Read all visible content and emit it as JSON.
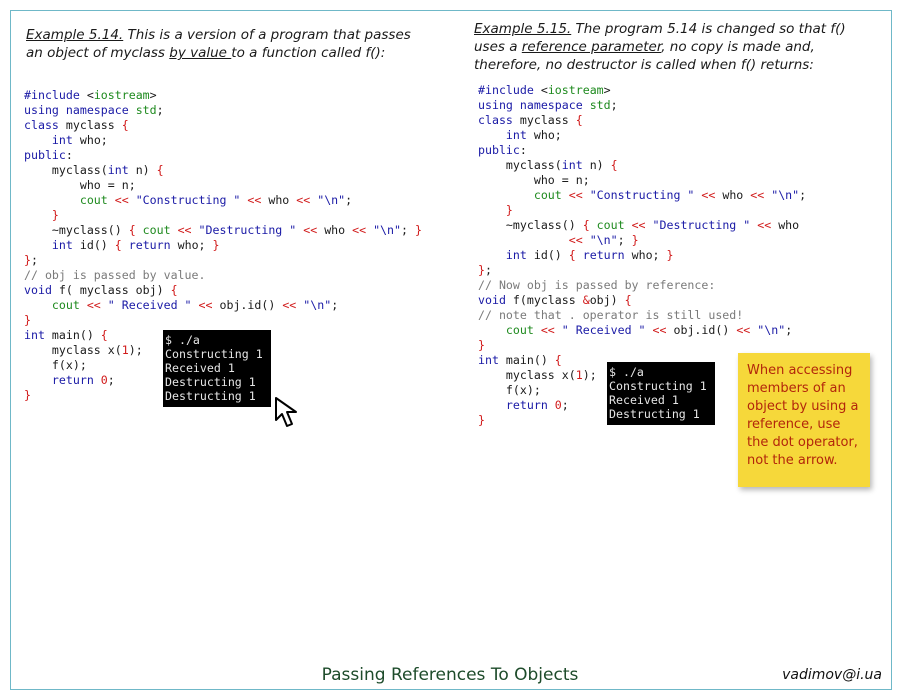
{
  "left": {
    "caption": {
      "ref": "Example 5.14.",
      "part1": " This is a version of a program that passes an object of myclass ",
      "by_value": "by value ",
      "part2": "to a function called f():"
    },
    "terminal": [
      "$ ./a",
      "Constructing 1",
      "Received 1",
      "Destructing 1",
      "Destructing 1"
    ]
  },
  "right": {
    "caption": {
      "ref": "Example 5.15.",
      "part1": " The program 5.14 is changed so that f() uses a ",
      "ref_param": "reference parameter",
      "part2": ", no copy is made and, therefore, no destructor is called when f() returns:"
    },
    "terminal": [
      "$ ./a",
      "Constructing 1",
      "Received 1",
      "Destructing 1"
    ]
  },
  "sticky_note": "When accessing members of an object by using a reference, use the dot operator, not the arrow.",
  "footer": {
    "title": "Passing References To Objects",
    "email": "vadimov@i.ua"
  },
  "icons": {
    "cursor": "mouse-pointer-icon"
  },
  "colors": {
    "frame": "#6fb8c8",
    "note_bg": "#f6d83a",
    "note_text": "#b3260b",
    "title": "#1d4b2a"
  }
}
